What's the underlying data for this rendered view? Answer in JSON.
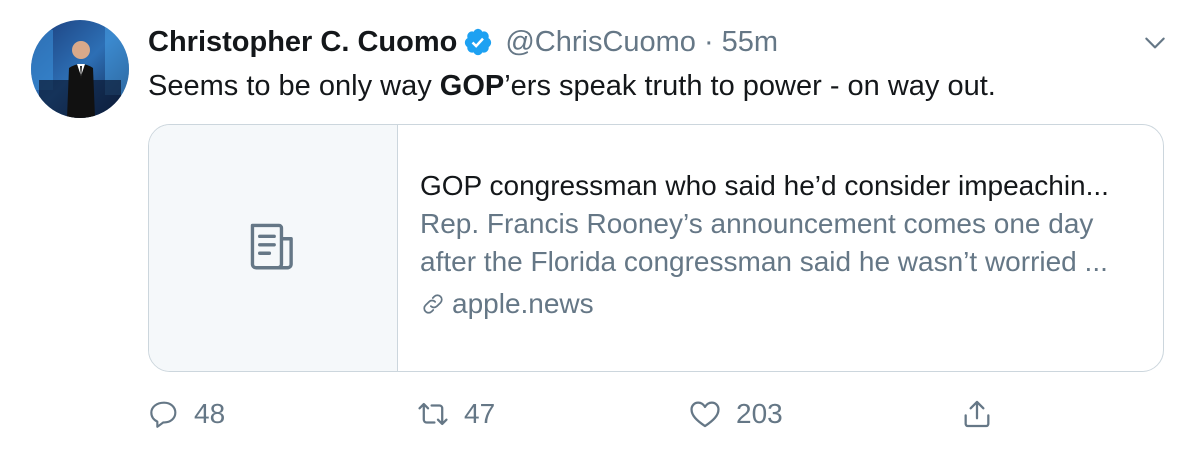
{
  "tweet": {
    "author_name": "Christopher C. Cuomo",
    "handle": "@ChrisCuomo",
    "separator": "·",
    "time": "55m",
    "text_before": "Seems to be only way ",
    "text_bold": "GOP",
    "text_after": "’ers speak truth to power - on way out."
  },
  "card": {
    "title": "GOP congressman who said he’d consider impeachin...",
    "description_line1": "Rep. Francis Rooney’s announcement comes one day",
    "description_line2": "after the Florida congressman said he wasn’t worried ...",
    "link": "apple.news"
  },
  "actions": {
    "replies": "48",
    "retweets": "47",
    "likes": "203"
  },
  "icons": {
    "verified": "verified-badge-icon",
    "more": "chevron-down-icon",
    "card": "document-icon",
    "link": "link-icon",
    "reply": "reply-icon",
    "retweet": "retweet-icon",
    "like": "heart-icon",
    "share": "share-icon"
  },
  "colors": {
    "primary_text": "#14171a",
    "secondary_text": "#657786",
    "verified_blue": "#1da1f2",
    "border": "#ccd6dd"
  }
}
